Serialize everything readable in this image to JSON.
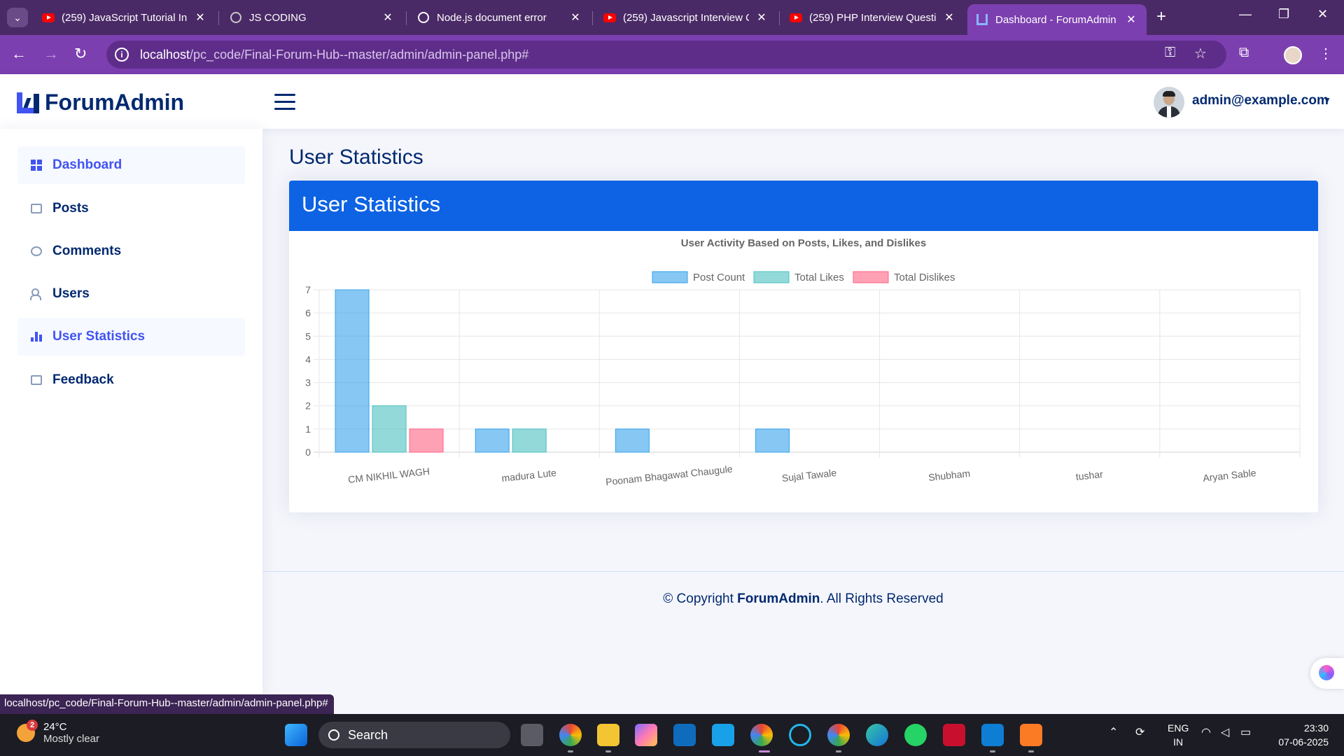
{
  "browser": {
    "tabs": [
      {
        "title": "(259) JavaScript Tutorial In",
        "icon": "youtube-icon"
      },
      {
        "title": "JS CODING",
        "icon": "globe-icon"
      },
      {
        "title": "Node.js document error",
        "icon": "chatgpt-icon"
      },
      {
        "title": "(259) Javascript Interview Q",
        "icon": "youtube-icon"
      },
      {
        "title": "(259) PHP Interview Questi",
        "icon": "youtube-icon"
      },
      {
        "title": "Dashboard - ForumAdmin",
        "icon": "forumadmin-icon",
        "active": true
      }
    ],
    "url_host": "localhost",
    "url_path": "/pc_code/Final-Forum-Hub--master/admin/admin-panel.php#"
  },
  "header": {
    "logo_text": "ForumAdmin",
    "user_email": "admin@example.com"
  },
  "sidebar": {
    "items": [
      {
        "label": "Dashboard",
        "icon": "grid-icon",
        "active": true
      },
      {
        "label": "Posts",
        "icon": "chat-square-icon"
      },
      {
        "label": "Comments",
        "icon": "chat-bubble-icon"
      },
      {
        "label": "Users",
        "icon": "people-icon"
      },
      {
        "label": "User Statistics",
        "icon": "bar-chart-icon",
        "active": true
      },
      {
        "label": "Feedback",
        "icon": "chat-square-icon"
      }
    ]
  },
  "main": {
    "page_title": "User Statistics",
    "card_title": "User Statistics"
  },
  "chart_data": {
    "type": "bar",
    "title": "User Activity Based on Posts, Likes, and Dislikes",
    "categories": [
      "CM NIKHIL WAGH",
      "madura Lute",
      "Poonam Bhagawat Chaugule",
      "Sujal Tawale",
      "Shubham",
      "tushar",
      "Aryan Sable"
    ],
    "series": [
      {
        "name": "Post Count",
        "values": [
          7,
          1,
          1,
          1,
          0,
          0,
          0
        ],
        "color": "#36a2eb"
      },
      {
        "name": "Total Likes",
        "values": [
          2,
          1,
          0,
          0,
          0,
          0,
          0
        ],
        "color": "#4bc0c0"
      },
      {
        "name": "Total Dislikes",
        "values": [
          1,
          0,
          0,
          0,
          0,
          0,
          0
        ],
        "color": "#ff6384"
      }
    ],
    "ylim": [
      0,
      7
    ],
    "yticks": [
      0,
      1,
      2,
      3,
      4,
      5,
      6,
      7
    ],
    "legend": "top-center",
    "grid": true
  },
  "footer": {
    "prefix": "© Copyright ",
    "brand": "ForumAdmin",
    "suffix": ". All Rights Reserved"
  },
  "status_bar_url": "localhost/pc_code/Final-Forum-Hub--master/admin/admin-panel.php#",
  "taskbar": {
    "weather_temp": "24°C",
    "weather_desc": "Mostly clear",
    "weather_badge": "2",
    "search_label": "Search",
    "lang_1": "ENG",
    "lang_2": "IN",
    "time": "23:30",
    "date": "07-06-2025"
  }
}
